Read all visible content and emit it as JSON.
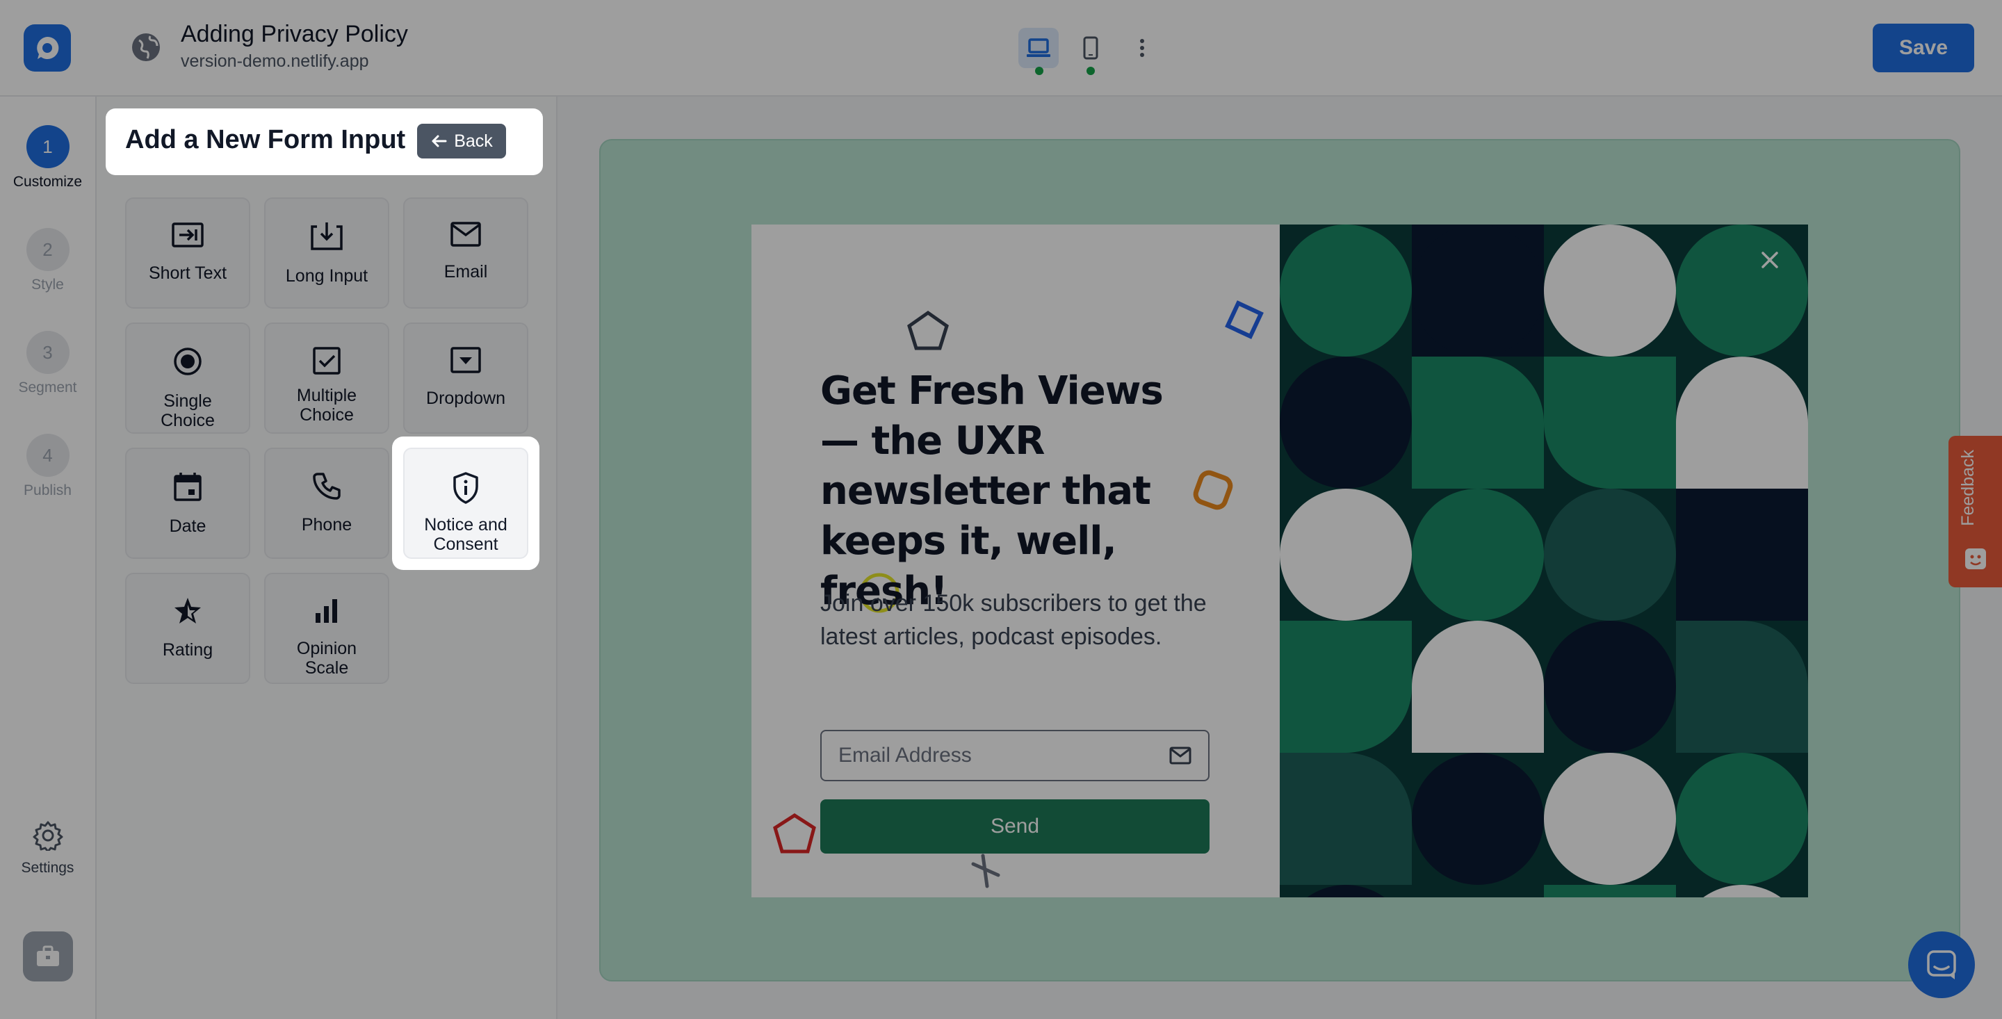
{
  "header": {
    "title": "Adding Privacy Policy",
    "url": "version-demo.netlify.app",
    "save_label": "Save"
  },
  "steps": [
    {
      "number": "1",
      "label": "Customize"
    },
    {
      "number": "2",
      "label": "Style"
    },
    {
      "number": "3",
      "label": "Segment"
    },
    {
      "number": "4",
      "label": "Publish"
    }
  ],
  "settings_label": "Settings",
  "panel": {
    "title": "Add a New Form Input",
    "back_label": "Back",
    "inputs": [
      {
        "label": "Short Text",
        "icon": "short-text-icon"
      },
      {
        "label": "Long Input",
        "icon": "long-input-icon"
      },
      {
        "label": "Email",
        "icon": "email-icon"
      },
      {
        "label": "Single Choice",
        "icon": "radio-icon"
      },
      {
        "label": "Multiple Choice",
        "icon": "checkbox-icon"
      },
      {
        "label": "Dropdown",
        "icon": "dropdown-icon"
      },
      {
        "label": "Date",
        "icon": "calendar-icon"
      },
      {
        "label": "Phone",
        "icon": "phone-icon"
      },
      {
        "label": "Notice and Consent",
        "icon": "shield-info-icon"
      },
      {
        "label": "Rating",
        "icon": "star-icon"
      },
      {
        "label": "Opinion Scale",
        "icon": "bar-chart-icon"
      }
    ]
  },
  "popup": {
    "headline": "Get Fresh Views — the UXR newsletter that keeps it, well, fresh!",
    "subtext": "Join over 150k subscribers to get the latest articles, podcast episodes.",
    "email_placeholder": "Email Address",
    "send_label": "Send"
  },
  "feedback_label": "Feedback",
  "colors": {
    "accent": "#1f6fe0",
    "send": "#1e7a57",
    "feedback": "#e85b3a"
  }
}
